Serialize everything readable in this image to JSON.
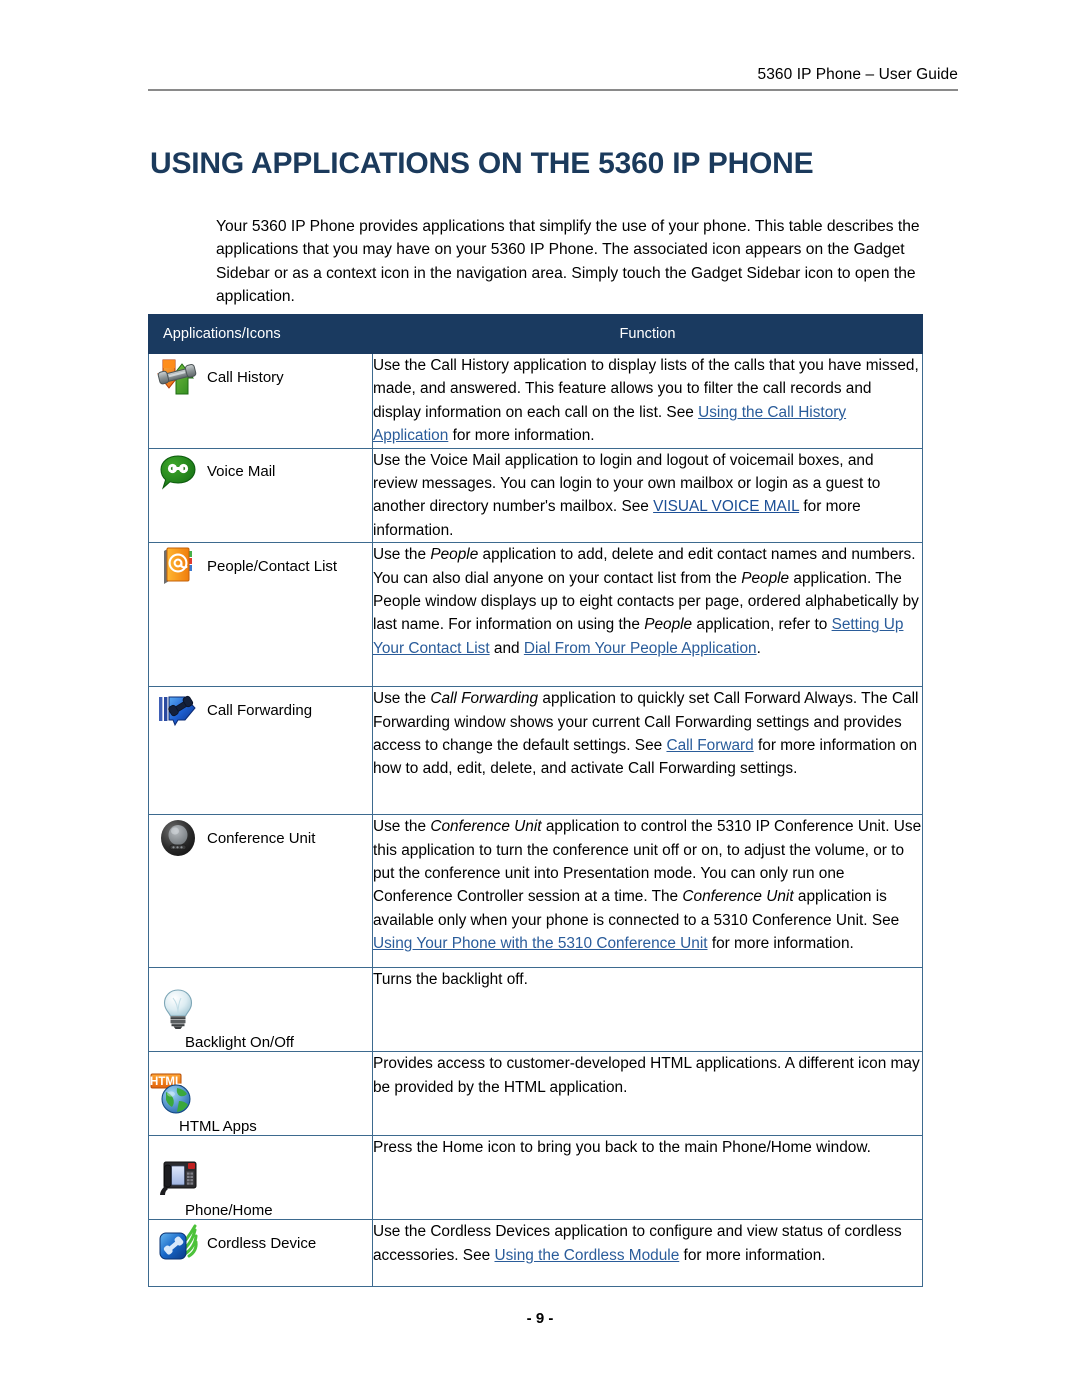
{
  "header": {
    "running_head": "5360 IP Phone – User Guide"
  },
  "title": "USING APPLICATIONS ON THE 5360 IP PHONE",
  "intro": "Your 5360 IP Phone provides applications that simplify the use of your phone. This table describes the applications that you may have on your 5360 IP Phone. The associated icon appears on the Gadget Sidebar or as a context icon in the navigation area. Simply touch the Gadget Sidebar icon to open the application.",
  "table": {
    "columns": {
      "applications": "Applications/Icons",
      "function": "Function"
    },
    "header_bg": "#1a3a60",
    "border_color": "#3d6a8f",
    "link_color": "#2a5c9a",
    "rows": [
      {
        "icon": "call-history-icon",
        "label": "Call History",
        "function_parts": [
          {
            "t": "text",
            "v": "Use the Call History application to display lists of the calls that you have missed, made, and answered. This feature allows you to filter the call records and display information on each call on the list. See "
          },
          {
            "t": "link",
            "v": "Using the Call History Application"
          },
          {
            "t": "text",
            "v": " for more information."
          }
        ]
      },
      {
        "icon": "voice-mail-icon",
        "label": "Voice Mail",
        "function_parts": [
          {
            "t": "text",
            "v": "Use the Voice Mail application to login and logout of voicemail boxes, and review messages. You can login to your own mailbox or login as a guest to another directory number's mailbox. See "
          },
          {
            "t": "link-caps",
            "v": "VISUAL VOICE MAIL"
          },
          {
            "t": "text",
            "v": " for more information."
          }
        ]
      },
      {
        "icon": "people-contact-list-icon",
        "label": "People/Contact List",
        "function_parts": [
          {
            "t": "text",
            "v": "Use the "
          },
          {
            "t": "em",
            "v": "People"
          },
          {
            "t": "text",
            "v": " application to add, delete and edit contact names and numbers. You can also dial anyone on your contact list from the "
          },
          {
            "t": "em",
            "v": "People"
          },
          {
            "t": "text",
            "v": " application. The People window displays up to eight contacts per page, ordered alphabetically by last name. For information on using the "
          },
          {
            "t": "em",
            "v": "People"
          },
          {
            "t": "text",
            "v": " application, refer to "
          },
          {
            "t": "link",
            "v": "Setting Up Your Contact List"
          },
          {
            "t": "text",
            "v": " and "
          },
          {
            "t": "link",
            "v": "Dial From Your People Application"
          },
          {
            "t": "text",
            "v": "."
          }
        ]
      },
      {
        "icon": "call-forwarding-icon",
        "label": "Call Forwarding",
        "function_parts": [
          {
            "t": "text",
            "v": "Use the "
          },
          {
            "t": "em",
            "v": "Call Forwarding"
          },
          {
            "t": "text",
            "v": " application to quickly set Call Forward Always. The Call Forwarding window shows your current Call Forwarding settings and provides access to change the default settings. See "
          },
          {
            "t": "link",
            "v": "Call Forward"
          },
          {
            "t": "text",
            "v": " for more information on how to add, edit, delete, and activate Call Forwarding settings."
          }
        ]
      },
      {
        "icon": "conference-unit-icon",
        "label": "Conference Unit",
        "function_parts": [
          {
            "t": "text",
            "v": "Use the "
          },
          {
            "t": "em",
            "v": "Conference Unit"
          },
          {
            "t": "text",
            "v": " application to control the 5310 IP Conference Unit. Use this application to turn the conference unit off or on, to adjust the volume, or to put the conference unit into Presentation mode. You can only run one Conference Controller session at a time. The "
          },
          {
            "t": "em",
            "v": "Conference Unit"
          },
          {
            "t": "text",
            "v": " application is available only when your phone is connected to a 5310 Conference Unit. See "
          },
          {
            "t": "link",
            "v": "Using Your Phone with the 5310 Conference Unit"
          },
          {
            "t": "text",
            "v": " for more information."
          }
        ]
      },
      {
        "icon": "backlight-icon",
        "label": "Backlight On/Off",
        "function_parts": [
          {
            "t": "text",
            "v": "Turns the backlight off."
          }
        ]
      },
      {
        "icon": "html-apps-icon",
        "label": "HTML Apps",
        "function_parts": [
          {
            "t": "text",
            "v": "Provides access to customer-developed HTML applications. A different icon may be provided by the HTML application."
          }
        ]
      },
      {
        "icon": "phone-home-icon",
        "label": "Phone/Home",
        "function_parts": [
          {
            "t": "text",
            "v": "Press the Home icon to bring you back to the main Phone/Home window."
          }
        ]
      },
      {
        "icon": "cordless-device-icon",
        "label": "Cordless Device",
        "function_parts": [
          {
            "t": "text",
            "v": "Use the Cordless Devices application to configure and view status of cordless accessories. See "
          },
          {
            "t": "link",
            "v": "Using the Cordless Module"
          },
          {
            "t": "text",
            "v": " for more information."
          }
        ]
      }
    ]
  },
  "footer": {
    "page_number": "- 9 -"
  }
}
